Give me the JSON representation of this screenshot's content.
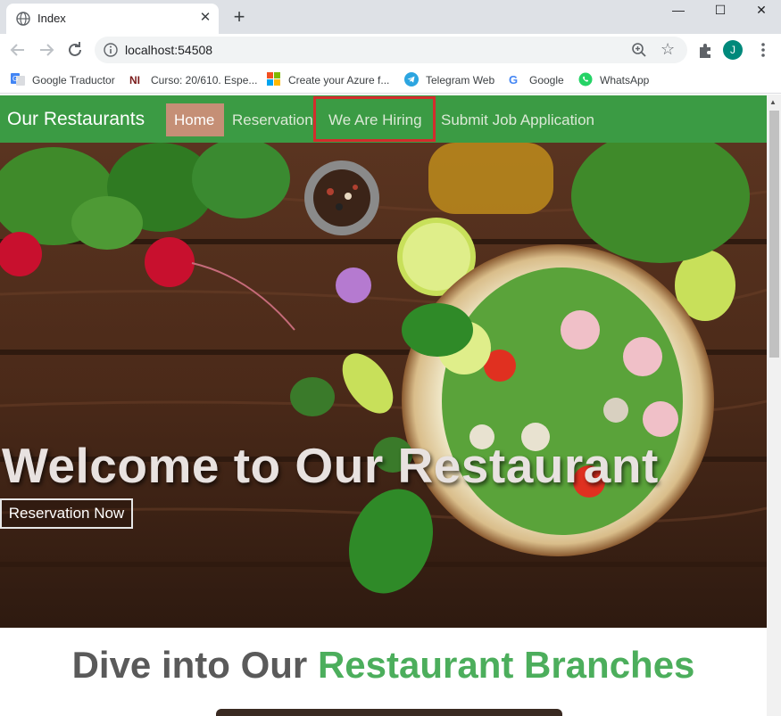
{
  "browser": {
    "tab_title": "Index",
    "tab_close": "✕",
    "new_tab": "+",
    "url": "localhost:54508",
    "avatar_initial": "J",
    "window_minimize": "—",
    "window_maximize": "☐",
    "window_close": "✕",
    "bookmarks": [
      {
        "label": "Google Traductor",
        "icon": "google-translate-icon"
      },
      {
        "label": "Curso: 20/610. Espe...",
        "icon": "ni-icon"
      },
      {
        "label": "Create your Azure f...",
        "icon": "microsoft-icon"
      },
      {
        "label": "Telegram Web",
        "icon": "telegram-icon"
      },
      {
        "label": "Google",
        "icon": "google-icon"
      },
      {
        "label": "WhatsApp",
        "icon": "whatsapp-icon"
      }
    ]
  },
  "navbar": {
    "brand": "Our Restaurants",
    "links": [
      {
        "label": "Home",
        "active": true
      },
      {
        "label": "Reservation"
      },
      {
        "label": "We Are Hiring",
        "highlighted": true
      },
      {
        "label": "Submit Job Application"
      }
    ],
    "background": "#3b9b44",
    "active_background": "#c58f76",
    "highlight_border": "#d32d2d"
  },
  "hero": {
    "title": "Welcome to Our Restaurant",
    "button": "Reservation Now"
  },
  "branches": {
    "title_part1": "Dive into Our",
    "title_part2": "Restaurant Branches",
    "accent_color": "#4cae5c"
  }
}
